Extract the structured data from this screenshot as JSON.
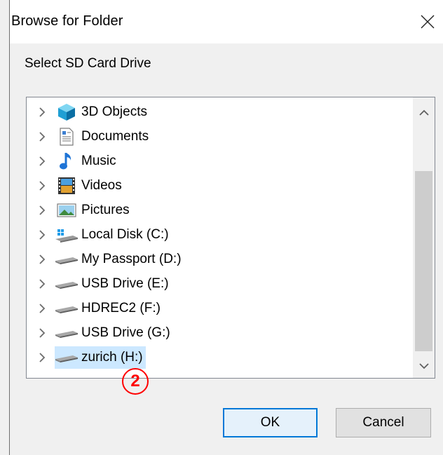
{
  "dialog": {
    "title": "Browse for Folder",
    "instruction": "Select SD Card Drive"
  },
  "tree": {
    "items": [
      {
        "label": "3D Objects",
        "icon": "3d-objects-icon"
      },
      {
        "label": "Documents",
        "icon": "documents-icon"
      },
      {
        "label": "Music",
        "icon": "music-icon"
      },
      {
        "label": "Videos",
        "icon": "videos-icon"
      },
      {
        "label": "Pictures",
        "icon": "pictures-icon"
      },
      {
        "label": "Local Disk (C:)",
        "icon": "local-disk-icon"
      },
      {
        "label": "My Passport (D:)",
        "icon": "drive-icon"
      },
      {
        "label": "USB Drive (E:)",
        "icon": "drive-icon"
      },
      {
        "label": "HDREC2 (F:)",
        "icon": "drive-icon"
      },
      {
        "label": "USB Drive (G:)",
        "icon": "drive-icon"
      },
      {
        "label": "zurich (H:)",
        "icon": "drive-icon",
        "selected": true
      }
    ]
  },
  "annotation": {
    "step_marker": "2",
    "color": "#ff0000"
  },
  "buttons": {
    "ok_label": "OK",
    "cancel_label": "Cancel"
  },
  "colors": {
    "selection": "#cce8ff",
    "accent": "#0078d7"
  }
}
